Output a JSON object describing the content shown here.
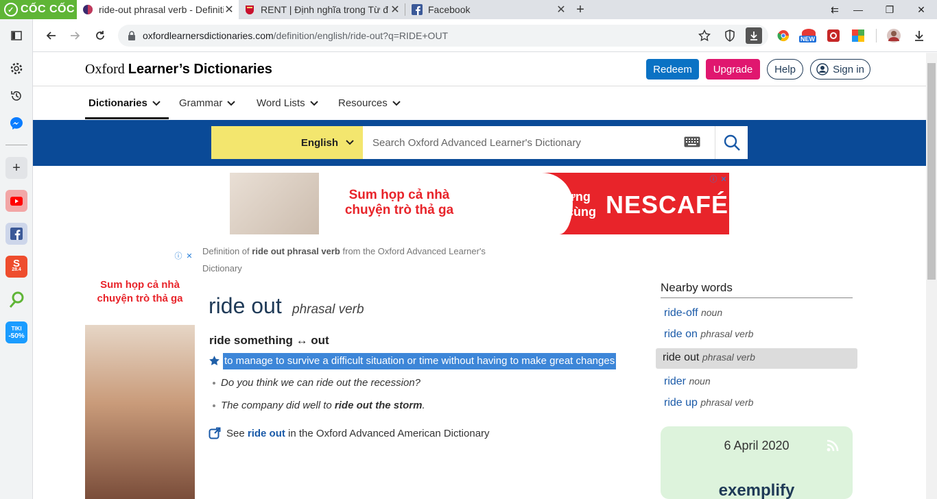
{
  "browser": {
    "brand": "CỐC CỐC",
    "tabs": [
      {
        "title": "ride-out phrasal verb - Definiti",
        "active": true
      },
      {
        "title": "RENT | Định nghĩa trong Từ đ"
      },
      {
        "title": "Facebook"
      }
    ],
    "url_host": "oxfordlearnersdictionaries.com",
    "url_path": "/definition/english/ride-out?q=RIDE+OUT",
    "extension_badge": "NEW"
  },
  "sidebar": {
    "tiki_label": "TIKI",
    "tiki_discount": "-50%",
    "shopee_date": "28.4"
  },
  "site": {
    "logo_light": "Oxford",
    "logo_bold": "Learner’s Dictionaries",
    "redeem": "Redeem",
    "upgrade": "Upgrade",
    "help": "Help",
    "sign_in": "Sign in",
    "nav": [
      "Dictionaries",
      "Grammar",
      "Word Lists",
      "Resources"
    ],
    "language": "English",
    "search_placeholder": "Search Oxford Advanced Learner's Dictionary"
  },
  "ads": {
    "top_text_1": "Sum họp cả nhà chuyện trò thả ga",
    "top_text_2": "Tận hưởng từng khoảnh khắc cùng",
    "top_brand": "NESCAFÉ.",
    "side_text": "Sum họp cả nhà chuyện trò thả ga"
  },
  "entry": {
    "breadcrumb_prefix": "Definition of",
    "breadcrumb_term": "ride out phrasal verb",
    "breadcrumb_suffix": "from the Oxford Advanced Learner's Dictionary",
    "headword": "ride out",
    "pos": "phrasal verb",
    "pattern": "ride something ↔ out",
    "definition": "to manage to survive a difficult situation or time without having to make great changes",
    "example_1": "Do you think we can ride out the recession?",
    "example_2_pre": "The company did well to",
    "example_2_bold": "ride out the storm",
    "example_2_post": ".",
    "see_prefix": "See",
    "see_link": "ride out",
    "see_suffix": "in the Oxford Advanced American Dictionary"
  },
  "nearby": {
    "title": "Nearby words",
    "items": [
      {
        "word": "ride-off",
        "pos": "noun"
      },
      {
        "word": "ride on",
        "pos": "phrasal verb"
      },
      {
        "word": "ride out",
        "pos": "phrasal verb"
      },
      {
        "word": "rider",
        "pos": "noun"
      },
      {
        "word": "ride up",
        "pos": "phrasal verb"
      }
    ]
  },
  "word_of_the_day": {
    "date": "6 April 2020",
    "word": "exemplify"
  },
  "colors": {
    "brand_green": "#5fb536",
    "redeem_blue": "#0a72c4",
    "upgrade_pink": "#e0176f",
    "search_bar_blue": "#0a4a97",
    "language_yellow": "#f3e66e",
    "selection_blue": "#3d86d8"
  }
}
